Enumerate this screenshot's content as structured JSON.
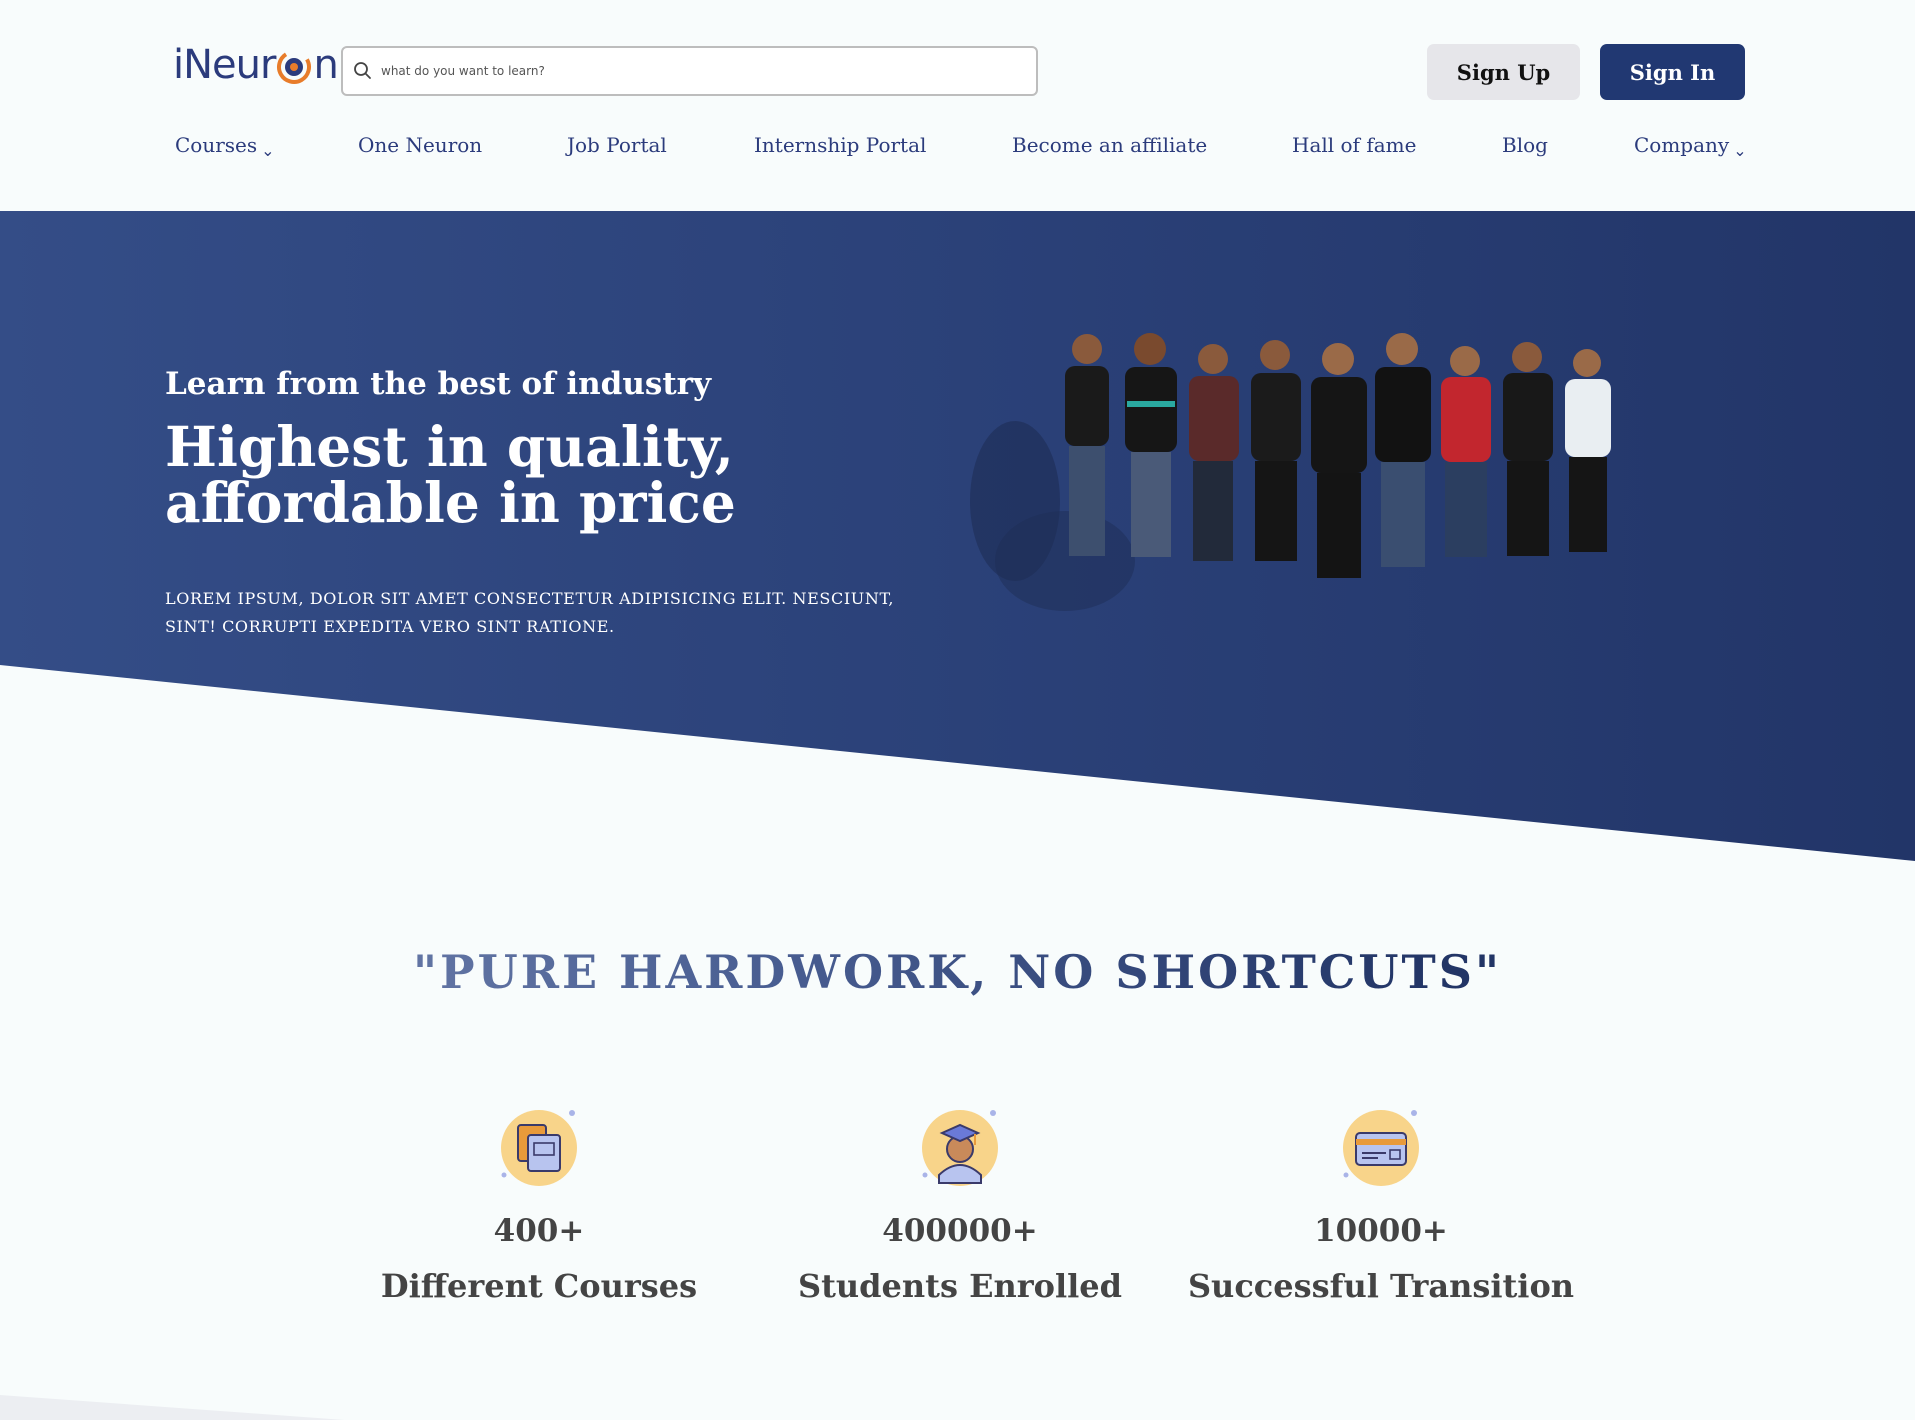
{
  "header": {
    "logo_text": {
      "before": "iNeur",
      "after": "n"
    },
    "search_placeholder": "what do you want to learn?",
    "signup_label": "Sign Up",
    "signin_label": "Sign In"
  },
  "nav": {
    "items": [
      {
        "label": "Courses",
        "has_dropdown": true
      },
      {
        "label": "One Neuron",
        "has_dropdown": false
      },
      {
        "label": "Job Portal",
        "has_dropdown": false
      },
      {
        "label": "Internship Portal",
        "has_dropdown": false
      },
      {
        "label": "Become an affiliate",
        "has_dropdown": false
      },
      {
        "label": "Hall of fame",
        "has_dropdown": false
      },
      {
        "label": "Blog",
        "has_dropdown": false
      },
      {
        "label": "Company",
        "has_dropdown": true
      }
    ],
    "chevron": "⌄"
  },
  "hero": {
    "kicker": "Learn from the best of industry",
    "title": "Highest in quality, affordable in price",
    "text": "LOREM IPSUM, DOLOR SIT AMET CONSECTETUR ADIPISICING ELIT. NESCIUNT, SINT! CORRUPTI EXPEDITA VERO SINT RATIONE."
  },
  "slogan": "\"PURE HARDWORK, NO SHORTCUTS\"",
  "stats": [
    {
      "icon": "books-icon",
      "number": "400+",
      "label": "Different Courses"
    },
    {
      "icon": "graduate-icon",
      "number": "400000+",
      "label": "Students Enrolled"
    },
    {
      "icon": "credit-card-icon",
      "number": "10000+",
      "label": "Successful Transition"
    }
  ],
  "colors": {
    "brand": "#213872",
    "logo_accent": "#e87c2a",
    "hero_bg": "#2a4077",
    "icon_circle": "#f8d48a"
  }
}
